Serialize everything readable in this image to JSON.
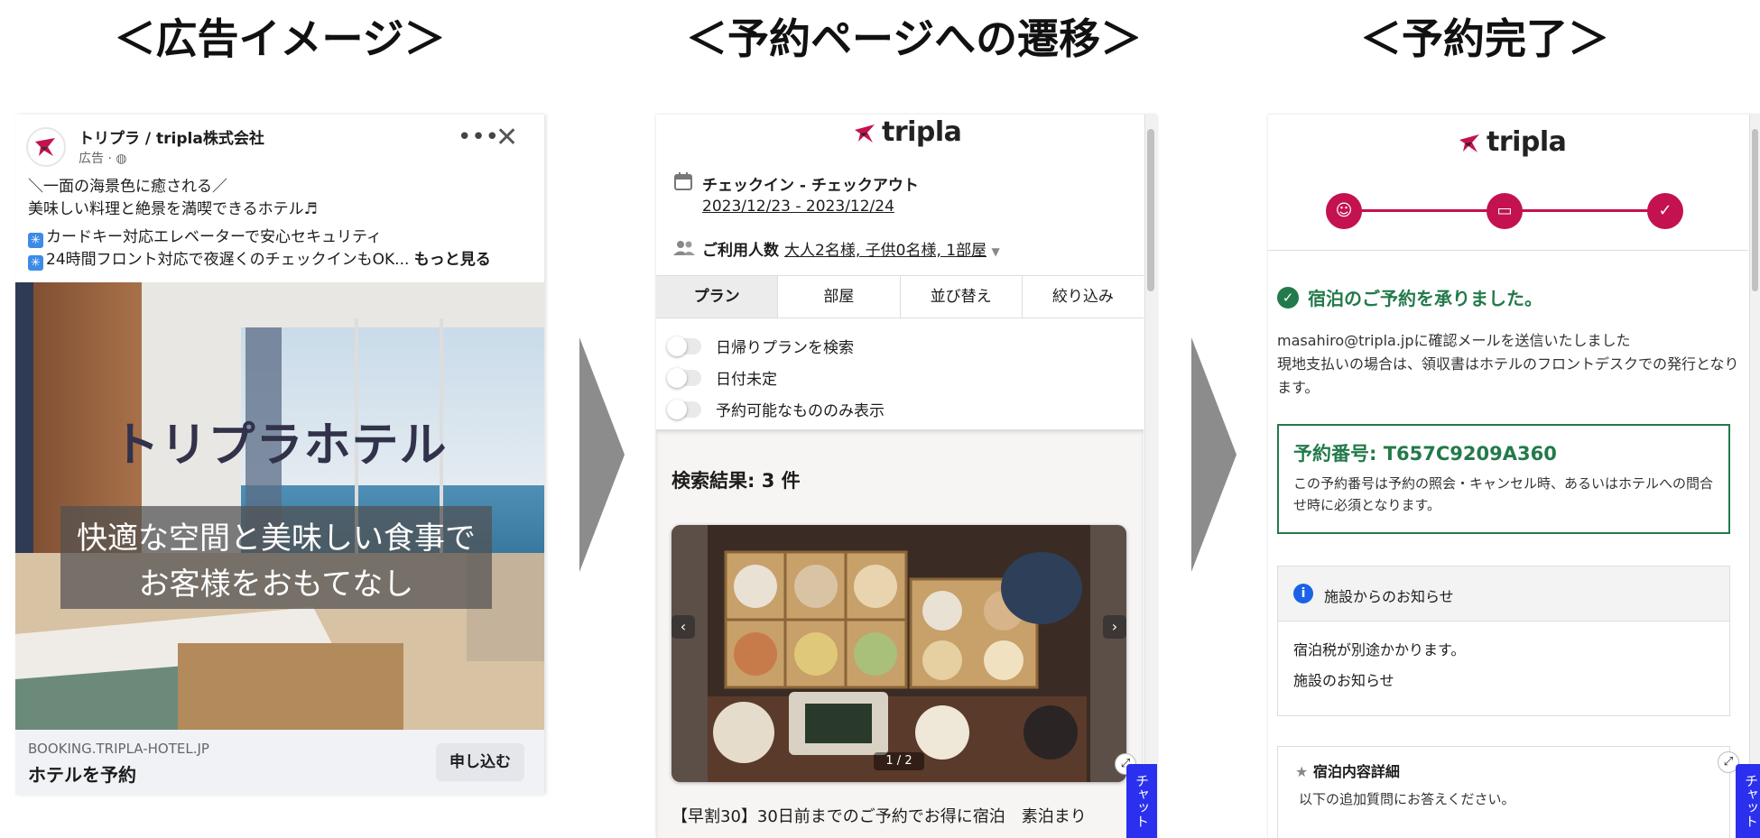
{
  "headings": {
    "ad": "＜広告イメージ＞",
    "booking": "＜予約ページへの遷移＞",
    "complete": "＜予約完了＞"
  },
  "ad": {
    "page_name": "トリプラ / tripla株式会社",
    "sponsored": "広告 · ",
    "body_line1": "＼一面の海景色に癒される／",
    "body_line2": "美味しい料理と絶景を満喫できるホテル♬",
    "body_line3": "カードキー対応エレベーターで安心セキュリティ",
    "body_line4": "24時間フロント対応で夜遅くのチェックインもOK...",
    "see_more": "もっと見る",
    "image_title": "トリプラホテル",
    "image_caption_1": "快適な空間と美味しい食事で",
    "image_caption_2": "お客様をおもてなし",
    "domain": "BOOKING.TRIPLA-HOTEL.JP",
    "cta_title": "ホテルを予約",
    "apply_button": "申し込む"
  },
  "booking": {
    "logo": "tripla",
    "dates_label": "チェックイン - チェックアウト",
    "dates_value": "2023/12/23 - 2023/12/24",
    "guests_label": "ご利用人数",
    "guests_value": "大人2名様, 子供0名様, 1部屋",
    "tabs": [
      "プラン",
      "部屋",
      "並び替え",
      "絞り込み"
    ],
    "toggles": [
      "日帰りプランを検索",
      "日付未定",
      "予約可能なもののみ表示"
    ],
    "results": "検索結果: 3 件",
    "image_counter": "1 / 2",
    "plan_title": "【早割30】30日前までのご予約でお得に宿泊　素泊まり",
    "chat": "チャット"
  },
  "complete": {
    "logo": "tripla",
    "success": "宿泊のご予約を承りました。",
    "msg_line1": "masahiro@tripla.jpに確認メールを送信いたしました",
    "msg_line2": "現地支払いの場合は、領収書はホテルのフロントデスクでの発行となります。",
    "reservation_number": "予約番号: T657C9209A360",
    "reservation_note": "この予約番号は予約の照会・キャンセル時、あるいはホテルへの問合せ時に必須となります。",
    "notice_title": "施設からのお知らせ",
    "notice_line1": "宿泊税が別途かかります。",
    "notice_line2": "施設のお知らせ",
    "detail_title": "宿泊内容詳細",
    "detail_sub": "以下の追加質問にお答えください。",
    "chat": "チャット"
  },
  "colors": {
    "brand": "#c3124f",
    "success": "#237a4a",
    "chat": "#2a30ee",
    "info": "#1b63e6"
  }
}
